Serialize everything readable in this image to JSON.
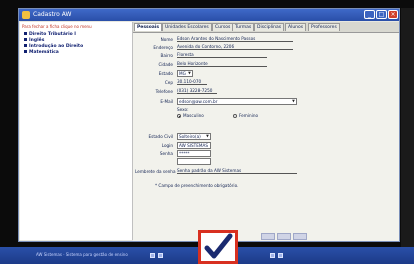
{
  "window": {
    "title": "Cadastro AW"
  },
  "sidebar": {
    "header": "Para fechar a ficha clique no menu",
    "items": [
      {
        "label": "Direito Tributário I"
      },
      {
        "label": "Inglês"
      },
      {
        "label": "Introdução ao Direito"
      },
      {
        "label": "Matemática"
      }
    ]
  },
  "tabs": [
    {
      "label": "Pessoais"
    },
    {
      "label": "Unidades Escolares"
    },
    {
      "label": "Cursos"
    },
    {
      "label": "Turmas"
    },
    {
      "label": "Disciplinas"
    },
    {
      "label": "Alunos"
    },
    {
      "label": "Professores"
    }
  ],
  "form": {
    "nome": {
      "label": "Nome",
      "value": "Edson Arantes do Nascimento Passos"
    },
    "endereco": {
      "label": "Endereço",
      "value": "Avenida do Contorno, 2206"
    },
    "bairro": {
      "label": "Bairro",
      "value": "Floresta"
    },
    "cidade": {
      "label": "Cidade",
      "value": "Belo Horizonte"
    },
    "estado": {
      "label": "Estado",
      "value": "MG"
    },
    "cep": {
      "label": "Cep",
      "value": "30.110-070"
    },
    "telefone": {
      "label": "Telefone",
      "value": "(031) 3228-7250"
    },
    "email": {
      "label": "E-Mail",
      "value": "edson@aw.com.br"
    },
    "sexo": {
      "label": "Sexo:",
      "options": [
        "Masculino",
        "Feminino"
      ],
      "selected": "Masculino"
    },
    "estado_civil": {
      "label": "Estado Civil",
      "value": "Solteiro(a)"
    },
    "login": {
      "label": "Login",
      "value": "AW SISTEMAS"
    },
    "senha": {
      "label": "Senha",
      "value": "*****"
    },
    "senha_confirm": {
      "value": ""
    },
    "lembrete": {
      "label": "Lembrete da senha",
      "value": "Senha padrão da AW Sistemas"
    },
    "note": "* Campo de preenchimento obrigatório."
  },
  "taskbar": {
    "text": "AW Sistemas · Sistema para gestão de ensino"
  },
  "colors": {
    "titlebar": "#2a4fa8",
    "taskbar": "#1c3a88",
    "logo_border": "#d83020",
    "check": "#1a2a70"
  },
  "icons": [
    "app-icon",
    "minimize-icon",
    "maximize-icon",
    "close-icon",
    "checkmark-logo-icon"
  ]
}
